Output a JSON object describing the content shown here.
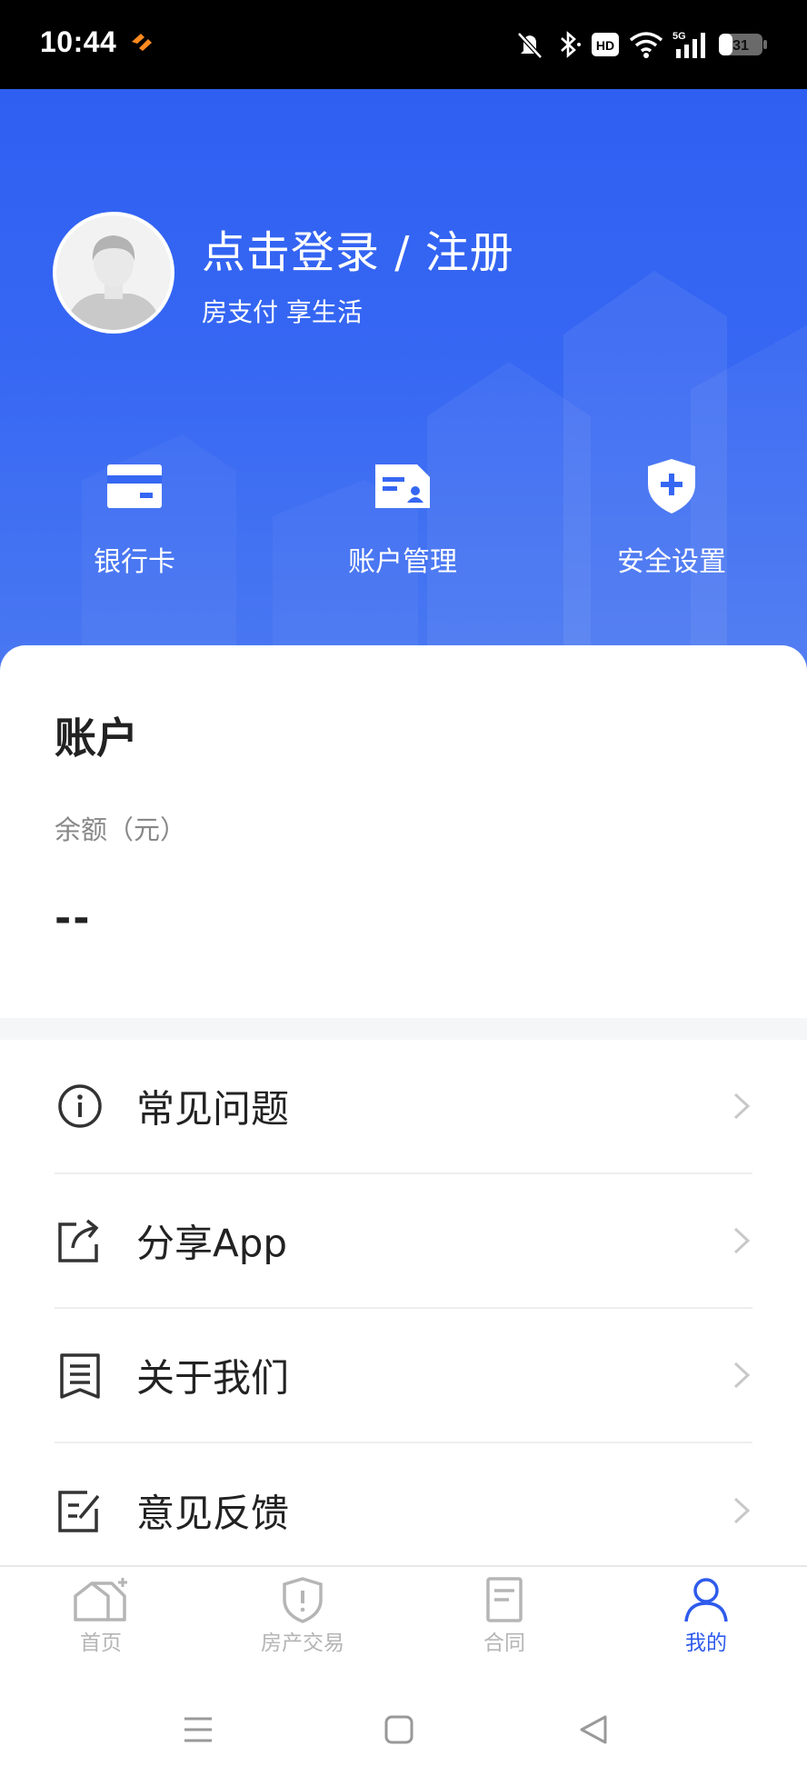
{
  "status_bar": {
    "time": "10:44",
    "network": "5G",
    "hd": "HD",
    "battery": "31"
  },
  "profile": {
    "login_text": "点击登录 / 注册",
    "slogan": "房支付 享生活"
  },
  "quick_entries": [
    {
      "label": "银行卡",
      "icon": "bank-card-icon"
    },
    {
      "label": "账户管理",
      "icon": "account-manage-icon"
    },
    {
      "label": "安全设置",
      "icon": "shield-plus-icon"
    }
  ],
  "account": {
    "title": "账户",
    "balance_label": "余额（元）",
    "balance_value": "--"
  },
  "menu": [
    {
      "label": "常见问题",
      "icon": "info-icon"
    },
    {
      "label": "分享App",
      "icon": "share-icon"
    },
    {
      "label": "关于我们",
      "icon": "document-icon"
    },
    {
      "label": "意见反馈",
      "icon": "feedback-edit-icon"
    }
  ],
  "tabs": [
    {
      "label": "首页",
      "icon": "home-icon",
      "active": false
    },
    {
      "label": "房产交易",
      "icon": "shield-alert-icon",
      "active": false
    },
    {
      "label": "合同",
      "icon": "contract-icon",
      "active": false
    },
    {
      "label": "我的",
      "icon": "person-icon",
      "active": true
    }
  ],
  "colors": {
    "brand_blue": "#3366f0",
    "tab_active": "#2e5bec",
    "tab_inactive": "#b5b5b5"
  }
}
